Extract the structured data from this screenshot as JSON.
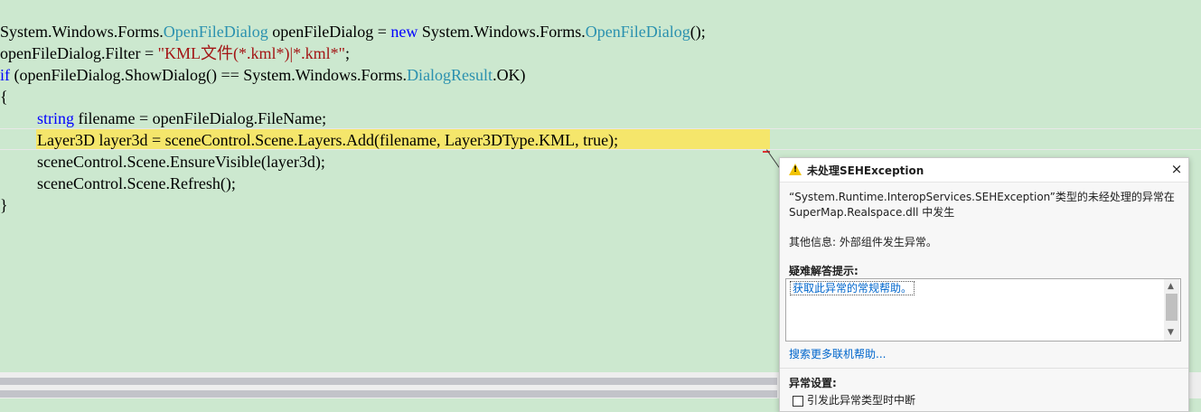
{
  "code": {
    "line1": {
      "a": "System.Windows.Forms.",
      "b": "OpenFileDialog",
      "c": " openFileDialog = ",
      "d": "new",
      "e": " System.Windows.Forms.",
      "f": "OpenFileDialog",
      "g": "();"
    },
    "line2": {
      "a": "openFileDialog.Filter = ",
      "b": "\"KML文件(*.kml*)|*.kml*\"",
      "c": ";"
    },
    "line3": {
      "a": "if",
      "b": " (openFileDialog.ShowDialog() == System.Windows.Forms.",
      "c": "DialogResult",
      "d": ".OK)"
    },
    "line4": "{",
    "line5": {
      "a": "string",
      "b": " filename = openFileDialog.FileName;"
    },
    "line6": "Layer3D layer3d = sceneControl.Scene.Layers.Add(filename, Layer3DType.KML, true);",
    "line7": "sceneControl.Scene.EnsureVisible(layer3d);",
    "line8": "sceneControl.Scene.Refresh();",
    "line9": "}"
  },
  "exception": {
    "title": "未处理SEHException",
    "close": "×",
    "message": "“System.Runtime.InteropServices.SEHException”类型的未经处理的异常在 SuperMap.Realspace.dll 中发生",
    "info": "其他信息: 外部组件发生异常。",
    "tips_title": "疑难解答提示:",
    "tips_link": "获取此异常的常规帮助。",
    "more_help": "搜索更多联机帮助...",
    "settings_title": "异常设置:",
    "checkbox_label": "引发此异常类型时中断"
  },
  "colors": {
    "editor_bg": "#cce8cf",
    "keyword": "#0000ff",
    "type": "#2b91af",
    "string": "#a31515",
    "highlight": "#f5e66b",
    "link": "#0066cc"
  },
  "icons": {
    "warning": "warning-icon",
    "close": "close-icon"
  }
}
